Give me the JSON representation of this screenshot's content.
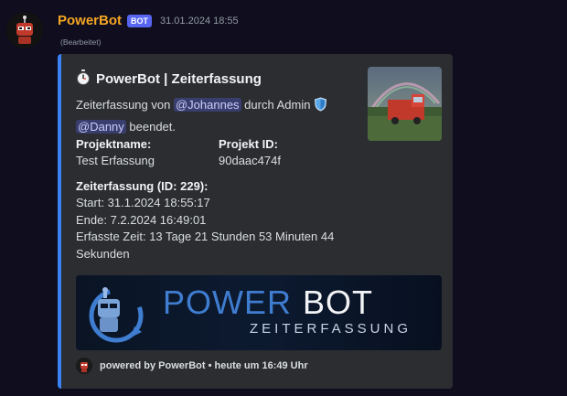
{
  "message": {
    "author": "PowerBot",
    "badge": "BOT",
    "timestamp": "31.01.2024 18:55",
    "edited": "(Bearbeitet)"
  },
  "embed": {
    "title": "PowerBot | Zeiterfassung",
    "title_icon": "stopwatch-icon",
    "description": {
      "prefix": "Zeiterfassung von",
      "mention_user": "@Johannes",
      "middle": "durch Admin",
      "mention_admin": "@Danny",
      "suffix": "beendet."
    },
    "fields": {
      "project_name_label": "Projektname:",
      "project_name_value": "Test Erfassung",
      "project_id_label": "Projekt ID:",
      "project_id_value": "90daac474f",
      "time_label": "Zeiterfassung (ID: 229):",
      "start": "Start: 31.1.2024 18:55:17",
      "end": "Ende: 7.2.2024 16:49:01",
      "duration": "Erfasste Zeit: 13 Tage 21 Stunden 53 Minuten 44 Sekunden"
    },
    "banner": {
      "line1_a": "POWER",
      "line1_b": "BOT",
      "line2": "ZEITERFASSUNG"
    },
    "footer": {
      "text": "powered by PowerBot",
      "separator": "•",
      "time": "heute um 16:49 Uhr"
    },
    "accent_color": "#3b82f6"
  }
}
